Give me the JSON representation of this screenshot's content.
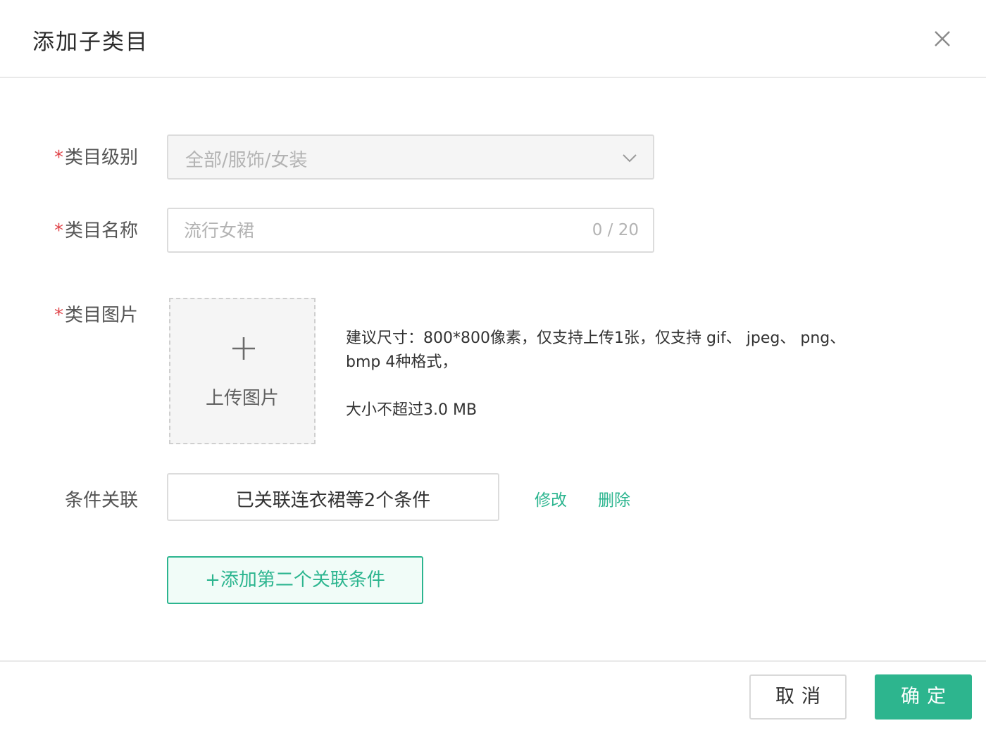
{
  "dialog": {
    "title": "添加子类目",
    "close_icon": "close-icon"
  },
  "form": {
    "level": {
      "required_mark": "*",
      "label": "类目级别",
      "value": "全部/服饰/女装",
      "icon": "chevron-down-icon"
    },
    "name": {
      "required_mark": "*",
      "label": "类目名称",
      "placeholder": "流行女裙",
      "value": "",
      "counter": "0 / 20"
    },
    "image": {
      "required_mark": "*",
      "label": "类目图片",
      "upload_label": "上传图片",
      "icon": "plus-icon",
      "hint_line1": "建议尺寸：800*800像素，仅支持上传1张，仅支持 gif、 jpeg、 png、",
      "hint_line2": "bmp 4种格式，",
      "hint_line3": "大小不超过3.0 MB"
    },
    "condition": {
      "label": "条件关联",
      "value": "已关联连衣裙等2个条件",
      "edit_label": "修改",
      "delete_label": "删除",
      "add_label": "+添加第二个关联条件"
    }
  },
  "footer": {
    "cancel_label": "取消",
    "ok_label": "确定"
  },
  "colors": {
    "accent": "#2cb58f",
    "required": "#e0464b",
    "border": "#dcdcdc",
    "muted": "#b3b3b3"
  }
}
